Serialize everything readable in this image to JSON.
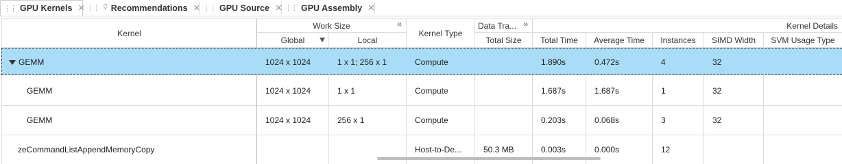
{
  "tabs": [
    {
      "label": "GPU Kernels",
      "active": true
    },
    {
      "label": "Recommendations",
      "active": false
    },
    {
      "label": "GPU Source",
      "active": false
    },
    {
      "label": "GPU Assembly",
      "active": false
    }
  ],
  "headers": {
    "kernel": "Kernel",
    "work_size": "Work Size",
    "global": "Global",
    "local": "Local",
    "kernel_type": "Kernel Type",
    "data_transfer": "Data Tra...",
    "total_size": "Total Size",
    "kernel_details": "Kernel Details",
    "total_time": "Total Time",
    "average_time": "Average Time",
    "instances": "Instances",
    "simd_width": "SIMD Width",
    "svm_usage_type": "SVM Usage Type"
  },
  "rows": [
    {
      "kernel": "GEMM",
      "global": "1024 x 1024",
      "local": "1 x 1; 256 x 1",
      "kernel_type": "Compute",
      "total_size": "",
      "total_time": "1.890s",
      "average_time": "0.472s",
      "instances": "4",
      "simd_width": "32",
      "svm_usage_type": ""
    },
    {
      "kernel": "GEMM",
      "global": "1024 x 1024",
      "local": "1 x 1",
      "kernel_type": "Compute",
      "total_size": "",
      "total_time": "1.687s",
      "average_time": "1.687s",
      "instances": "1",
      "simd_width": "32",
      "svm_usage_type": ""
    },
    {
      "kernel": "GEMM",
      "global": "1024 x 1024",
      "local": "256 x 1",
      "kernel_type": "Compute",
      "total_size": "",
      "total_time": "0.203s",
      "average_time": "0.068s",
      "instances": "3",
      "simd_width": "32",
      "svm_usage_type": ""
    },
    {
      "kernel": "zeCommandListAppendMemoryCopy",
      "global": "",
      "local": "",
      "kernel_type": "Host-to-De...",
      "total_size": "50.3 MB",
      "total_time": "0.003s",
      "average_time": "0.000s",
      "instances": "12",
      "simd_width": "",
      "svm_usage_type": ""
    }
  ],
  "colors": {
    "selection": "#a9dcf7",
    "grid_line": "#dcdcdc"
  }
}
